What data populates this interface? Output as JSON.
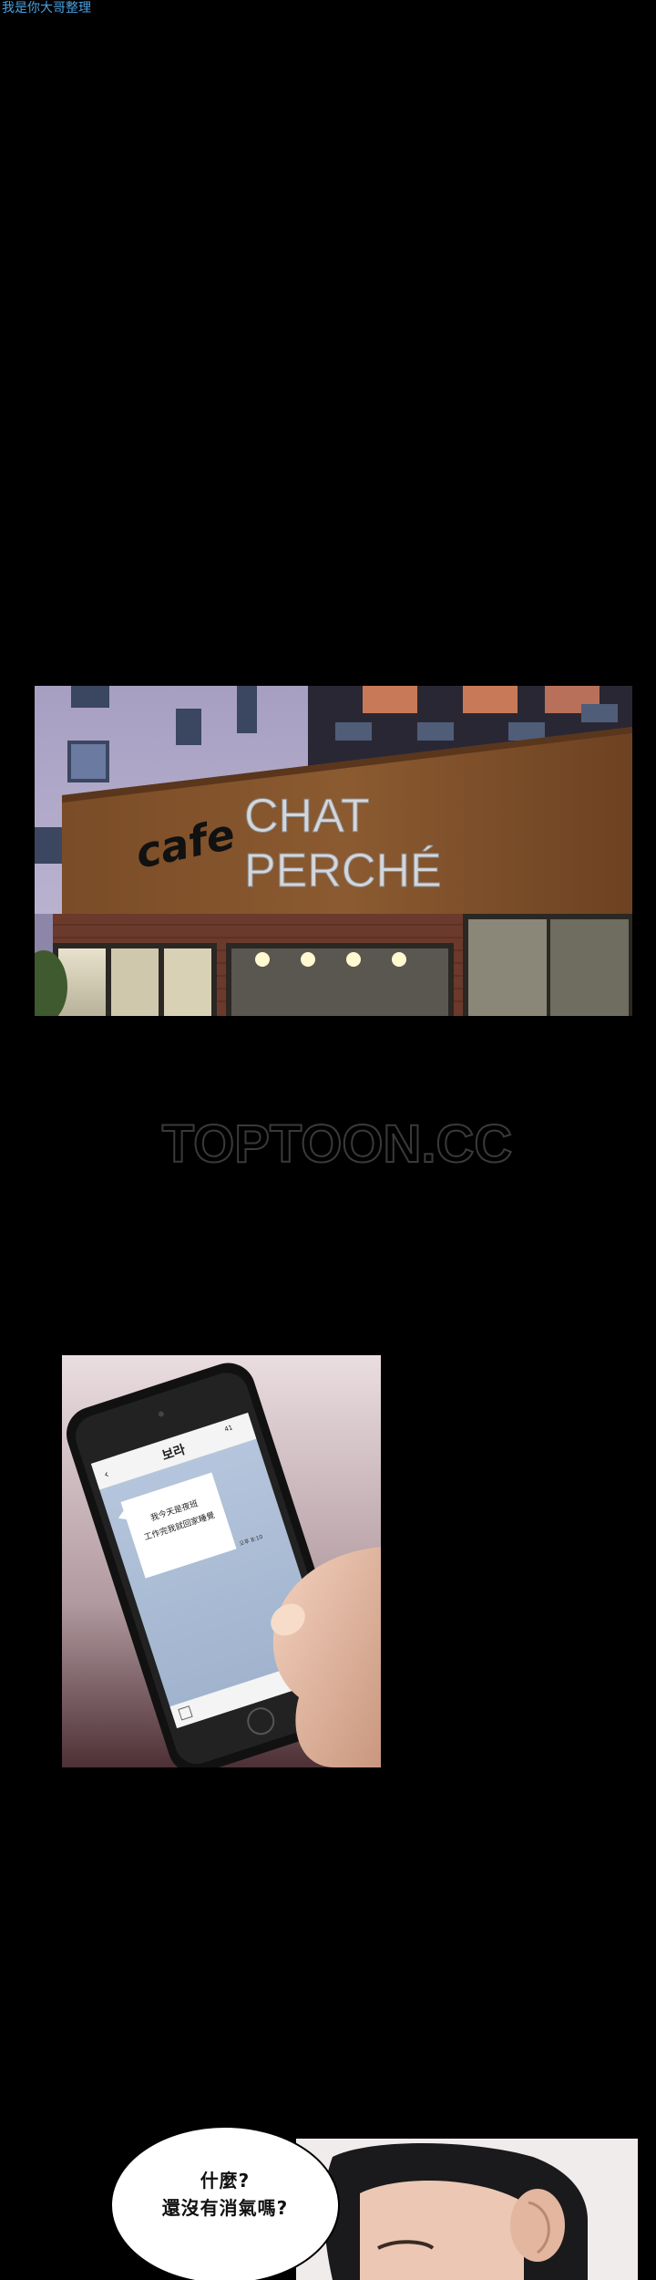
{
  "credit": "我是你大哥整理",
  "cafe_sign": {
    "script": "cafe",
    "line1": "CHAT",
    "line2": "PERCHÉ"
  },
  "watermark": "TOPTOON.CC",
  "phone": {
    "contact": "보라",
    "message_line1": "我今天是夜班",
    "message_line2": "工作完我就回家睡覺",
    "time": "오후 8:10",
    "status_num": "41"
  },
  "speech": {
    "line1": "什麼?",
    "line2": "還沒有消氣嗎?"
  }
}
